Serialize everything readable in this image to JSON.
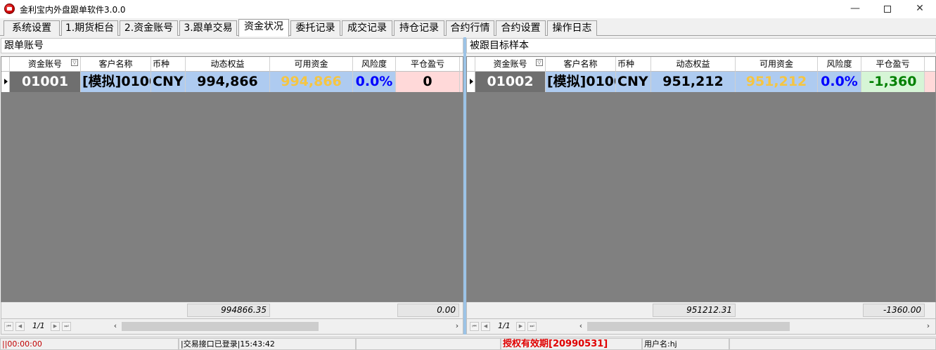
{
  "window": {
    "title": "金利宝内外盘跟单软件3.0.0",
    "min": "—",
    "close": "✕"
  },
  "tabs": [
    {
      "label": "系统设置",
      "active": false
    },
    {
      "label": "1.期货柜台",
      "active": false
    },
    {
      "label": "2.资金账号",
      "active": false
    },
    {
      "label": "3.跟单交易",
      "active": false
    },
    {
      "label": "资金状况",
      "active": true
    },
    {
      "label": "委托记录",
      "active": false
    },
    {
      "label": "成交记录",
      "active": false
    },
    {
      "label": "持仓记录",
      "active": false
    },
    {
      "label": "合约行情",
      "active": false
    },
    {
      "label": "合约设置",
      "active": false
    },
    {
      "label": "操作日志",
      "active": false
    }
  ],
  "left_panel": {
    "title": "跟单账号",
    "columns": [
      "资金账号",
      "客户名称",
      "币种",
      "动态权益",
      "可用资金",
      "风险度",
      "平仓盈亏"
    ],
    "row": {
      "account": "01001",
      "name": "[模拟]0100",
      "currency": "CNY",
      "equity": "994,866",
      "available": "994,866",
      "risk": "0.0%",
      "pnl": "0"
    },
    "footer_equity": "994866.35",
    "footer_pnl": "0.00",
    "page": "1/1"
  },
  "right_panel": {
    "title": "被跟目标样本",
    "columns": [
      "资金账号",
      "客户名称",
      "币种",
      "动态权益",
      "可用资金",
      "风险度",
      "平仓盈亏"
    ],
    "row": {
      "account": "01002",
      "name": "[模拟]0100",
      "currency": "CNY",
      "equity": "951,212",
      "available": "951,212",
      "risk": "0.0%",
      "pnl": "-1,360"
    },
    "footer_equity": "951212.31",
    "footer_pnl": "-1360.00",
    "page": "1/1"
  },
  "status": {
    "timer": "||00:00:00",
    "login": "|交易接口已登录|15:43:42",
    "license": "授权有效期[20990531]",
    "user": "用户名:hj"
  },
  "colors": {
    "grid_bg": "#808080",
    "account_bg": "#6f6f6f",
    "equity_bg": "#aecbf0",
    "available_text": "#f5c542",
    "risk_text": "#0000ff",
    "pnl_zero_bg": "#ffd9d9",
    "pnl_loss_bg": "#d6f5d6",
    "pnl_loss_text": "#008000",
    "license_text": "#e00000",
    "splitter": "#9cc3e6"
  }
}
